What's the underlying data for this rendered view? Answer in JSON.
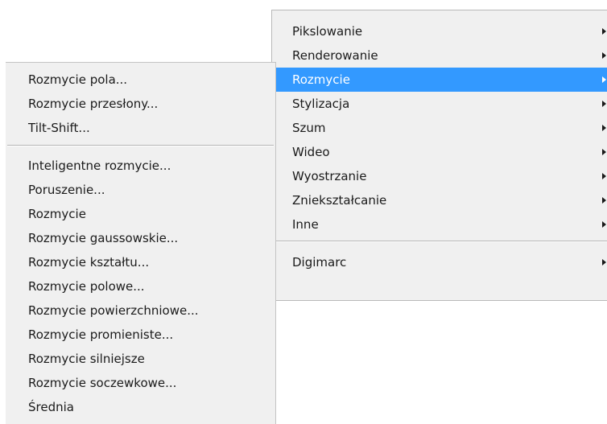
{
  "main_menu": {
    "items": [
      {
        "label": "Pikslowanie",
        "has_submenu": true
      },
      {
        "label": "Renderowanie",
        "has_submenu": true
      },
      {
        "label": "Rozmycie",
        "has_submenu": true,
        "highlighted": true
      },
      {
        "label": "Stylizacja",
        "has_submenu": true
      },
      {
        "label": "Szum",
        "has_submenu": true
      },
      {
        "label": "Wideo",
        "has_submenu": true
      },
      {
        "label": "Wyostrzanie",
        "has_submenu": true
      },
      {
        "label": "Zniekształcanie",
        "has_submenu": true
      },
      {
        "label": "Inne",
        "has_submenu": true
      },
      {
        "label": "Digimarc",
        "has_submenu": true
      }
    ]
  },
  "sub_menu": {
    "items": [
      {
        "label": "Rozmycie pola..."
      },
      {
        "label": "Rozmycie przesłony..."
      },
      {
        "label": "Tilt-Shift..."
      },
      {
        "label": "Inteligentne rozmycie..."
      },
      {
        "label": "Poruszenie..."
      },
      {
        "label": "Rozmycie"
      },
      {
        "label": "Rozmycie gaussowskie..."
      },
      {
        "label": "Rozmycie kształtu..."
      },
      {
        "label": "Rozmycie polowe..."
      },
      {
        "label": "Rozmycie powierzchniowe..."
      },
      {
        "label": "Rozmycie promieniste..."
      },
      {
        "label": "Rozmycie silniejsze"
      },
      {
        "label": "Rozmycie soczewkowe..."
      },
      {
        "label": "Średnia"
      }
    ]
  },
  "colors": {
    "menu_background": "#f0f0f0",
    "highlight_background": "#3399ff",
    "highlight_text": "#ffffff",
    "text": "#1a1a1a"
  }
}
